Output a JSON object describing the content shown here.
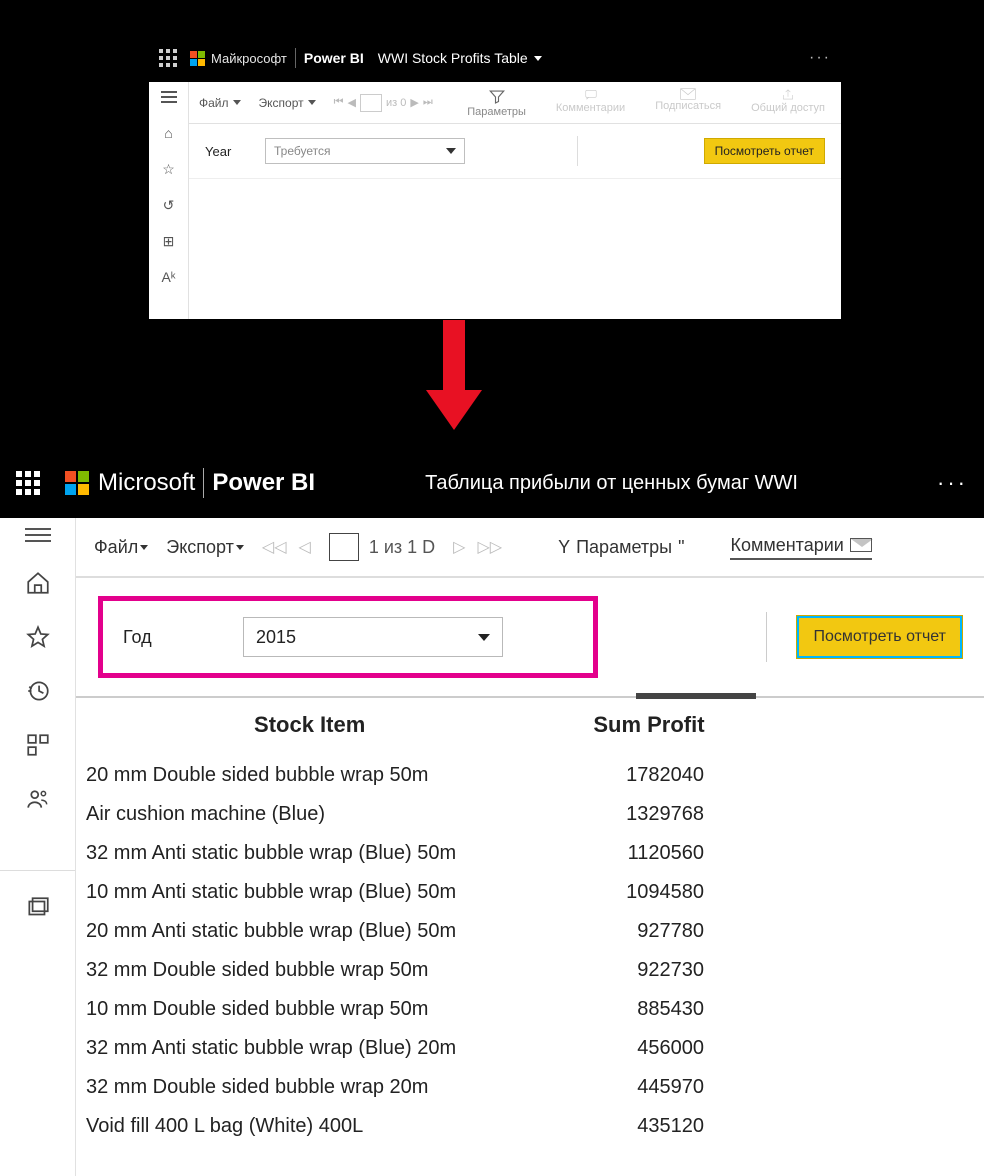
{
  "panel1": {
    "brand": "Майкрософт",
    "product": "Power BI",
    "title": "WWI Stock Profits Table",
    "toolbar": {
      "file": "Файл",
      "export": "Экспорт",
      "of_label": "из 0",
      "parameters": "Параметры",
      "comments": "Комментарии",
      "subscribe": "Подписаться",
      "share": "Общий доступ"
    },
    "params": {
      "label": "Year",
      "placeholder": "Требуется",
      "view_btn": "Посмотреть отчет"
    }
  },
  "panel2": {
    "brand": "Microsoft",
    "product": "Power BI",
    "title": "Таблица прибыли от ценных бумаг WWI",
    "toolbar": {
      "file": "Файл",
      "export": "Экспорт",
      "pager": "1 из 1 D",
      "params_prefix": "Y",
      "parameters": "Параметры",
      "params_suffix": "\"",
      "comments": "Комментарии"
    },
    "params": {
      "label": "Год",
      "value": "2015",
      "view_btn": "Посмотреть отчет"
    },
    "table": {
      "col_item": "Stock Item",
      "col_profit": "Sum Profit",
      "rows": [
        {
          "item": "20 mm Double sided bubble wrap 50m",
          "profit": "1782040"
        },
        {
          "item": "Air cushion machine (Blue)",
          "profit": "1329768"
        },
        {
          "item": "32 mm Anti static bubble wrap (Blue) 50m",
          "profit": "1120560"
        },
        {
          "item": "10 mm Anti static bubble wrap (Blue) 50m",
          "profit": "1094580"
        },
        {
          "item": "20 mm Anti static bubble wrap (Blue) 50m",
          "profit": "927780"
        },
        {
          "item": "32 mm Double sided bubble wrap 50m",
          "profit": "922730"
        },
        {
          "item": "10 mm Double sided bubble wrap 50m",
          "profit": "885430"
        },
        {
          "item": "32 mm Anti static bubble wrap (Blue) 20m",
          "profit": "456000"
        },
        {
          "item": "32 mm Double sided bubble wrap 20m",
          "profit": "445970"
        },
        {
          "item": "Void fill 400 L bag (White) 400L",
          "profit": "435120"
        }
      ]
    }
  }
}
